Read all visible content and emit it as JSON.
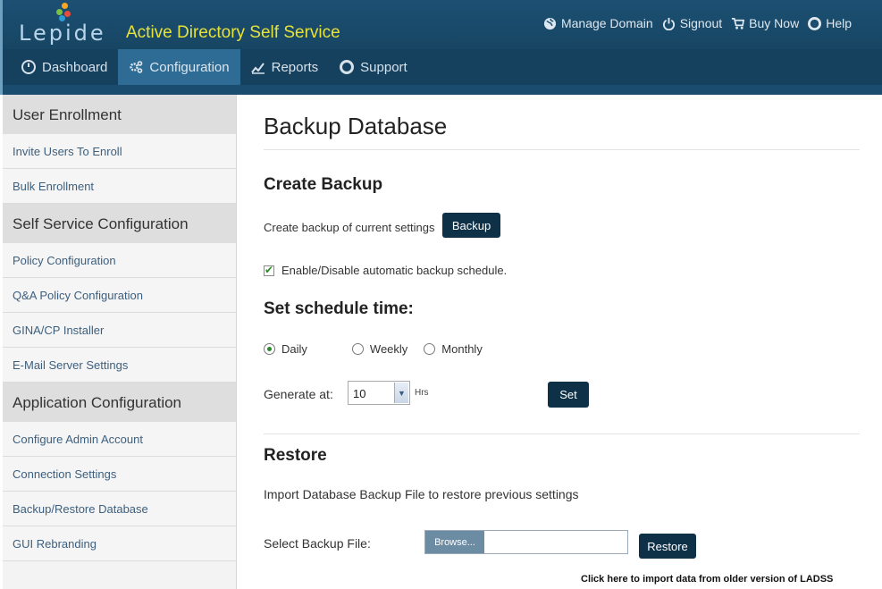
{
  "header": {
    "logo_text": "Lepide",
    "app_title": "Active Directory Self Service",
    "links": [
      {
        "label": "Manage Domain",
        "icon": "globe-icon"
      },
      {
        "label": "Signout",
        "icon": "power-icon"
      },
      {
        "label": "Buy Now",
        "icon": "cart-icon"
      },
      {
        "label": "Help",
        "icon": "lifebuoy-icon"
      }
    ]
  },
  "nav": {
    "items": [
      {
        "label": "Dashboard",
        "icon": "dashboard-icon"
      },
      {
        "label": "Configuration",
        "icon": "gear-icon"
      },
      {
        "label": "Reports",
        "icon": "chart-icon"
      },
      {
        "label": "Support",
        "icon": "lifebuoy-icon"
      }
    ],
    "active": "Configuration"
  },
  "sidebar": {
    "sections": [
      {
        "title": "User Enrollment",
        "items": [
          "Invite Users To Enroll",
          "Bulk Enrollment"
        ]
      },
      {
        "title": "Self Service Configuration",
        "items": [
          "Policy Configuration",
          "Q&A Policy Configuration",
          "GINA/CP Installer",
          "E-Mail Server Settings"
        ]
      },
      {
        "title": "Application Configuration",
        "items": [
          "Configure Admin Account",
          "Connection Settings",
          "Backup/Restore Database",
          "GUI Rebranding"
        ]
      }
    ]
  },
  "main": {
    "title": "Backup Database",
    "create": {
      "heading": "Create Backup",
      "label": "Create backup of current settings",
      "button": "Backup",
      "auto_checkbox_label": "Enable/Disable automatic backup schedule.",
      "auto_checked": true
    },
    "schedule": {
      "heading": "Set schedule time:",
      "options": [
        "Daily",
        "Weekly",
        "Monthly"
      ],
      "selected": "Daily",
      "generate_label": "Generate at:",
      "generate_value": "10",
      "unit": "Hrs",
      "set_button": "Set"
    },
    "restore": {
      "heading": "Restore",
      "description": "Import Database Backup File to restore previous settings",
      "select_label": "Select Backup File:",
      "browse_label": "Browse...",
      "restore_button": "Restore",
      "import_link": "Click here to import data from older version of LADSS"
    }
  },
  "colors": {
    "header_bg": "#1c4f73",
    "nav_active": "#2e6b95",
    "title_yellow": "#e6e23a",
    "button_dark": "#0f3147"
  }
}
